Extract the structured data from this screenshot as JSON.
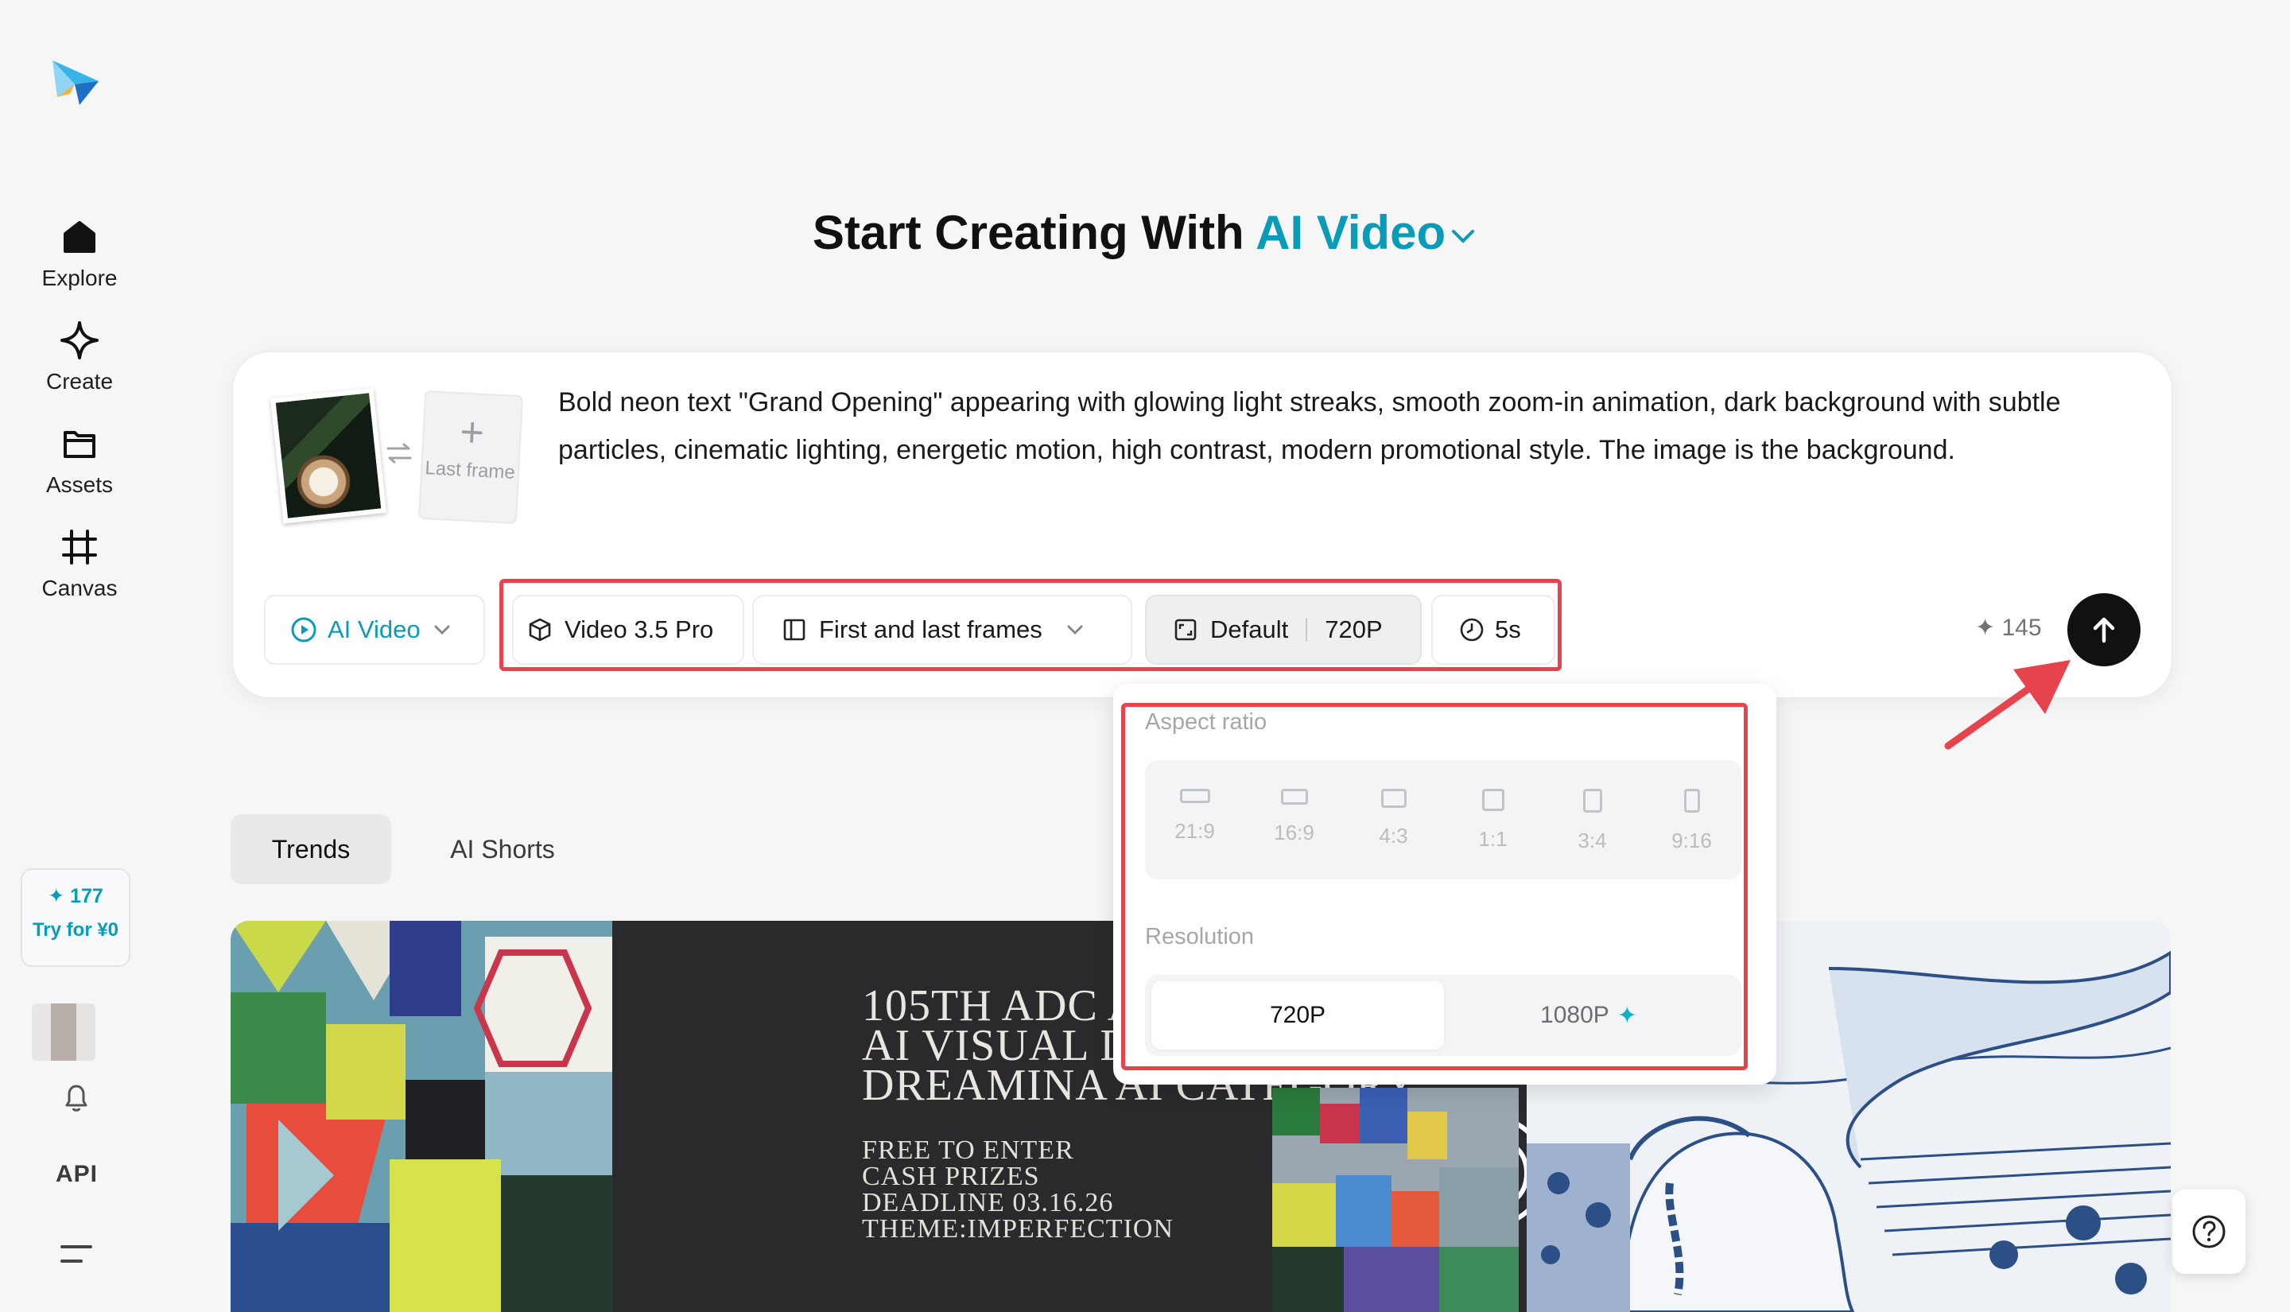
{
  "sidebar": {
    "items": [
      {
        "label": "Explore",
        "icon": "home-icon"
      },
      {
        "label": "Create",
        "icon": "sparkle-icon"
      },
      {
        "label": "Assets",
        "icon": "folder-icon"
      },
      {
        "label": "Canvas",
        "icon": "frame-icon"
      }
    ],
    "credits": "✦ 177",
    "try_label": "Try for ¥0",
    "api_label": "API"
  },
  "heading": {
    "prefix": "Start Creating With ",
    "accent": "AI Video"
  },
  "prompt": {
    "text": "Bold neon text \"Grand Opening\" appearing with glowing light streaks, smooth zoom-in animation, dark background with subtle particles, cinematic lighting, energetic motion, high contrast, modern promotional style. The image is the background.",
    "last_frame_label": "Last frame"
  },
  "toolbar": {
    "mode": "AI Video",
    "model": "Video 3.5 Pro",
    "frames": "First and last frames",
    "ratio": "Default",
    "resolution": "720P",
    "duration": "5s",
    "cost": "✦ 145"
  },
  "dropdown": {
    "aspect_label": "Aspect ratio",
    "ratios": [
      "21:9",
      "16:9",
      "4:3",
      "1:1",
      "3:4",
      "9:16"
    ],
    "resolution_label": "Resolution",
    "resolutions": [
      "720P",
      "1080P"
    ],
    "selected_resolution": "720P"
  },
  "tabs": [
    "Trends",
    "AI Shorts"
  ],
  "gallery": {
    "poster_title": "105TH ADC ANNUAL AWARDS\nAI VISUAL DESIGN\nDREAMINA AI CATEGORY",
    "poster_details": "FREE TO ENTER\nCASH PRIZES\nDEADLINE 03.16.26\nTHEME:IMPERFECTION"
  },
  "colors": {
    "accent": "#0a9bb8",
    "highlight_red": "#e5444d",
    "send_button": "#111111"
  }
}
